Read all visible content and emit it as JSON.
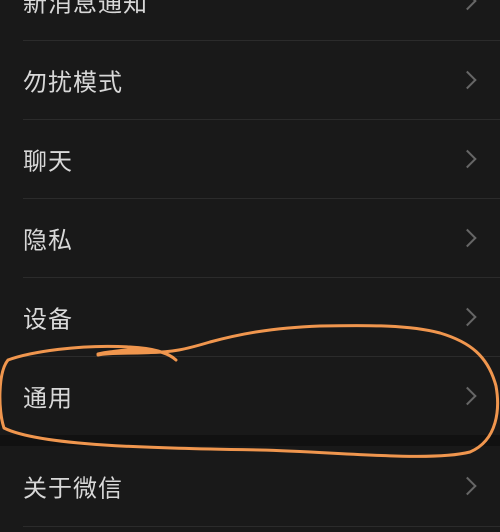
{
  "settings": {
    "items": [
      {
        "label": "新消息通知"
      },
      {
        "label": "勿扰模式"
      },
      {
        "label": "聊天"
      },
      {
        "label": "隐私"
      },
      {
        "label": "设备"
      },
      {
        "label": "通用"
      },
      {
        "label": "关于微信"
      }
    ]
  },
  "colors": {
    "background": "#191919",
    "text": "#d8d8d8",
    "chevron": "#666666",
    "annotation": "#f0964e"
  },
  "annotation": {
    "shape": "hand-drawn-loop",
    "highlighted_item": "通用"
  }
}
